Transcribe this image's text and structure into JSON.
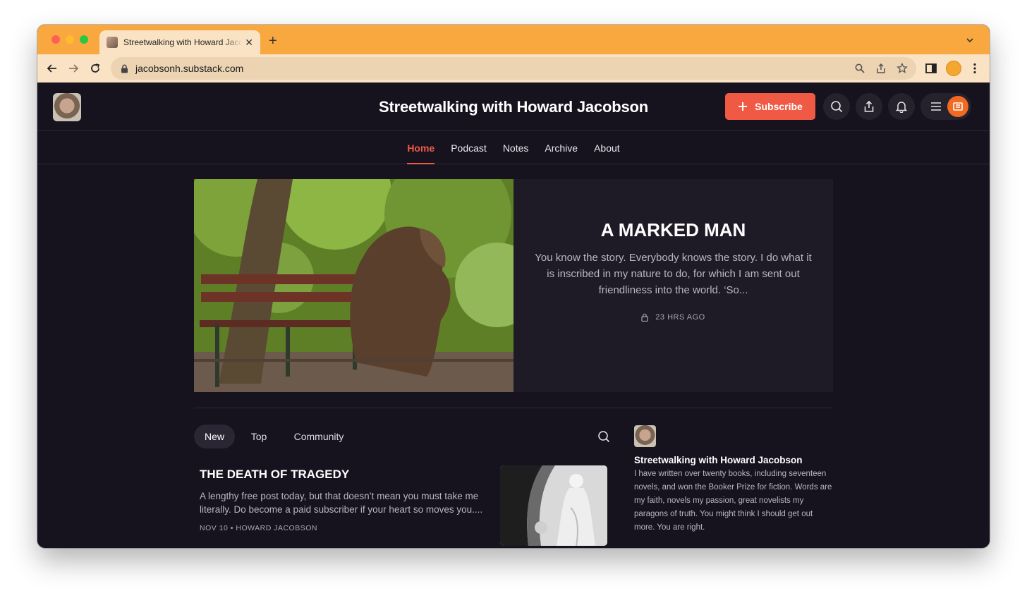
{
  "browser": {
    "tab_title": "Streetwalking with Howard Jacobson",
    "url": "jacobsonh.substack.com"
  },
  "colors": {
    "accent": "#f05a45",
    "page_bg": "#16131f",
    "chrome_tab_bar": "#f9a83f",
    "chrome_toolbar": "#fae3c4"
  },
  "header": {
    "title": "Streetwalking with Howard Jacobson",
    "subscribe_label": "Subscribe",
    "icons": [
      "search-icon",
      "share-icon",
      "bell-icon",
      "menu-icon",
      "substack-logo-icon"
    ]
  },
  "nav": {
    "items": [
      "Home",
      "Podcast",
      "Notes",
      "Archive",
      "About"
    ],
    "active": "Home"
  },
  "featured": {
    "title": "A MARKED MAN",
    "excerpt": "You know the story. Everybody knows the story. I do what it is inscribed in my nature to do, for which I am sent out friendliness into the world. ‘So...",
    "meta": "23 HRS AGO"
  },
  "filters": {
    "items": [
      "New",
      "Top",
      "Community"
    ],
    "active": "New"
  },
  "posts": [
    {
      "title": "THE DEATH OF TRAGEDY",
      "excerpt": "A lengthy free post today, but that doesn’t mean you must take me literally. Do become a paid subscriber if your heart so moves you....",
      "meta": "NOV 10 • HOWARD JACOBSON"
    }
  ],
  "sidebar": {
    "name": "Streetwalking with Howard Jacobson",
    "description": "I have written over twenty books, including seventeen novels, and won the Booker Prize for fiction. Words are my faith, novels my passion, great novelists my paragons of truth. You might think I should get out more. You are right."
  }
}
